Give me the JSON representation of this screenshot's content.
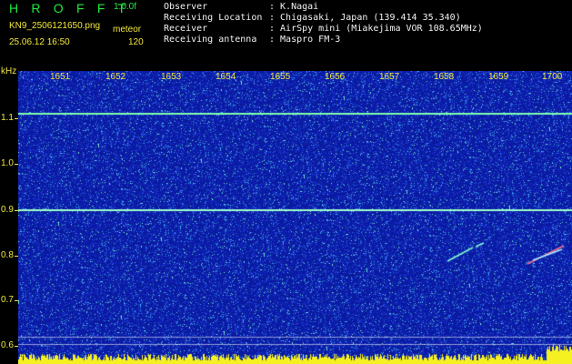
{
  "header": {
    "app_title": "H R O F F T",
    "version": "1.0.0f",
    "filename": "KN9_2506121650.png",
    "datetime": "25.06.12 16:50",
    "meteor_label": "meteor",
    "meteor_count": "120"
  },
  "info": [
    {
      "label": "Observer",
      "value": ": K.Nagai"
    },
    {
      "label": "Receiving Location",
      "value": ": Chigasaki, Japan (139.414 35.340)"
    },
    {
      "label": "Receiver",
      "value": ": AirSpy mini (Miakejima VOR 108.65MHz)"
    },
    {
      "label": "Receiving antenna",
      "value": ": Maspro FM-3"
    }
  ],
  "axis": {
    "unit": "kHz",
    "x_ticks": [
      "1651",
      "1652",
      "1653",
      "1654",
      "1655",
      "1656",
      "1657",
      "1658",
      "1659",
      "1700"
    ],
    "y_ticks": [
      "1.1",
      "1.0",
      "0.9",
      "0.8",
      "0.7",
      "0.6"
    ]
  },
  "colors": {
    "background": "#0a1aa0",
    "signal": "#7fffb0",
    "label": "#f2e83a"
  }
}
